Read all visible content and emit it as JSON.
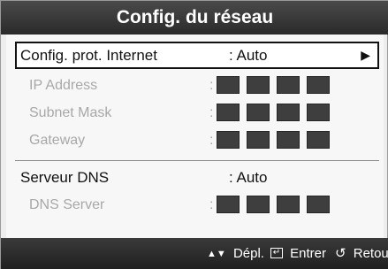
{
  "title": "Config. du réseau",
  "rows": {
    "internet_protocol": {
      "label": "Config. prot. Internet",
      "value": ": Auto",
      "arrow": "▶"
    },
    "ip_address": {
      "label": "IP Address"
    },
    "subnet_mask": {
      "label": "Subnet Mask"
    },
    "gateway": {
      "label": "Gateway"
    },
    "dns": {
      "label": "Serveur DNS",
      "value": ": Auto"
    },
    "dns_server": {
      "label": "DNS Server"
    }
  },
  "colon": ":",
  "footer": {
    "move_icon": "▲▼",
    "move_label": "Dépl.",
    "enter_icon": "↵",
    "enter_label": "Entrer",
    "return_icon": "↺",
    "return_label": "Retour"
  }
}
